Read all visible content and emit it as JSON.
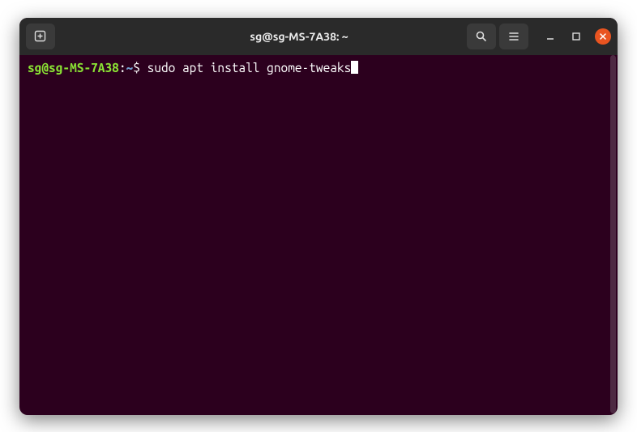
{
  "titlebar": {
    "title": "sg@sg-MS-7A38: ~"
  },
  "prompt": {
    "user_host": "sg@sg-MS-7A38",
    "colon": ":",
    "path": "~",
    "symbol": "$ ",
    "command": "sudo apt install gnome-tweaks"
  }
}
